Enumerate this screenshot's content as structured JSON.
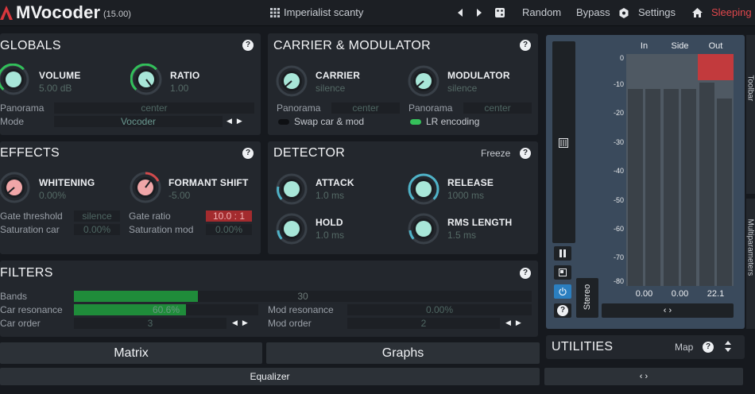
{
  "app": {
    "title": "MVocoder",
    "version": "(15.00)"
  },
  "toolbar": {
    "preset_name": "Imperialist scanty",
    "random_label": "Random",
    "bypass_label": "Bypass",
    "settings_label": "Settings",
    "status_label": "Sleeping",
    "status_color": "#e0474c"
  },
  "globals": {
    "title": "GLOBALS",
    "volume": {
      "label": "VOLUME",
      "value": "5.00 dB"
    },
    "ratio": {
      "label": "RATIO",
      "value": "1.00"
    },
    "panorama_label": "Panorama",
    "panorama_value": "center",
    "mode_label": "Mode",
    "mode_value": "Vocoder"
  },
  "carrier_modulator": {
    "title": "CARRIER & MODULATOR",
    "carrier": {
      "label": "CARRIER",
      "value": "silence"
    },
    "modulator": {
      "label": "MODULATOR",
      "value": "silence"
    },
    "carrier_panorama_label": "Panorama",
    "carrier_panorama_value": "center",
    "modulator_panorama_label": "Panorama",
    "modulator_panorama_value": "center",
    "swap_label": "Swap car & mod",
    "swap_on": false,
    "lr_label": "LR encoding",
    "lr_on": true
  },
  "effects": {
    "title": "EFFECTS",
    "whitening": {
      "label": "WHITENING",
      "value": "0.00%"
    },
    "formant": {
      "label": "FORMANT SHIFT",
      "value": "-5.00"
    },
    "gate_threshold_label": "Gate threshold",
    "gate_threshold_value": "silence",
    "gate_ratio_label": "Gate ratio",
    "gate_ratio_value": "10.0 : 1",
    "saturation_car_label": "Saturation car",
    "saturation_car_value": "0.00%",
    "saturation_mod_label": "Saturation mod",
    "saturation_mod_value": "0.00%"
  },
  "detector": {
    "title": "DETECTOR",
    "freeze_label": "Freeze",
    "attack": {
      "label": "ATTACK",
      "value": "1.0 ms"
    },
    "release": {
      "label": "RELEASE",
      "value": "1000 ms"
    },
    "hold": {
      "label": "HOLD",
      "value": "1.0 ms"
    },
    "rms": {
      "label": "RMS LENGTH",
      "value": "1.5 ms"
    }
  },
  "filters": {
    "title": "FILTERS",
    "bands_label": "Bands",
    "bands_value": "30",
    "bands_fill": 0.27,
    "car_res_label": "Car resonance",
    "car_res_value": "60.6%",
    "car_res_fill": 0.606,
    "car_order_label": "Car order",
    "car_order_value": "3",
    "mod_res_label": "Mod resonance",
    "mod_res_value": "0.00%",
    "mod_order_label": "Mod order",
    "mod_order_value": "2"
  },
  "meters": {
    "in_label": "In",
    "side_label": "Side",
    "out_label": "Out",
    "scale": [
      "0",
      "-10",
      "-20",
      "-30",
      "-40",
      "-50",
      "-60",
      "-70",
      "-80"
    ],
    "in_value": "0.00",
    "side_value": "0.00",
    "out_value": "22.1",
    "stereo_label": "Stereo",
    "expand_arrows": "‹ ›"
  },
  "side_tabs": {
    "top": "Toolbar",
    "bottom": "Multiparameters"
  },
  "bottom": {
    "matrix_label": "Matrix",
    "graphs_label": "Graphs",
    "equalizer_label": "Equalizer",
    "utilities_label": "UTILITIES",
    "map_label": "Map",
    "expand_arrows": "‹ ›"
  },
  "colors": {
    "accent_green": "#35c05a",
    "knob_teal": "#a8e6d8",
    "knob_pink": "#f0a6a8",
    "meter_red": "#c23a3d",
    "bar_green": "#1f8c3a"
  }
}
